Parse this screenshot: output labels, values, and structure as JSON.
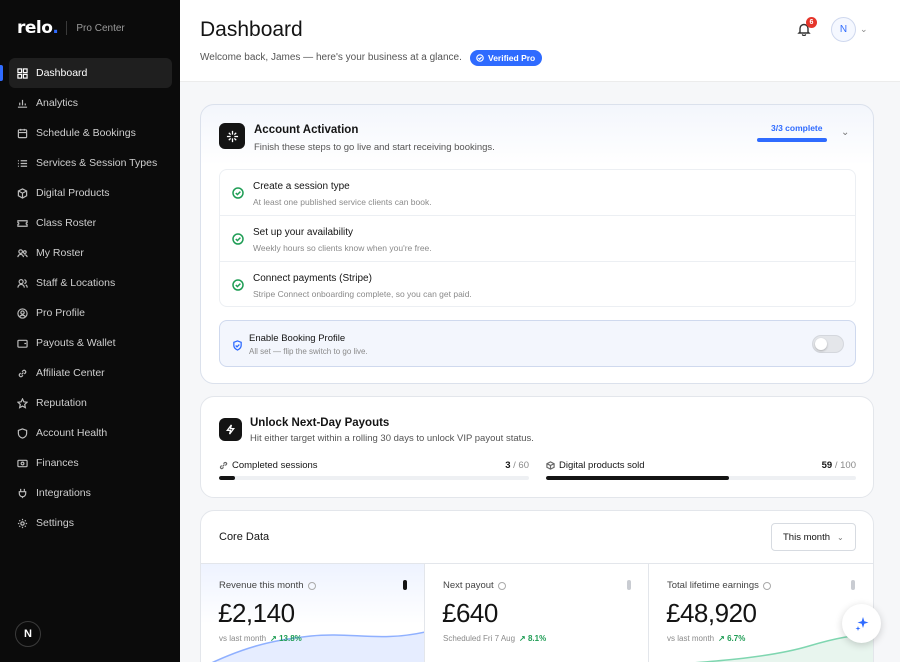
{
  "brand": {
    "logo": "relo",
    "logo_dot": ".",
    "sub": "Pro Center"
  },
  "sidebar": {
    "items": [
      {
        "label": "Dashboard",
        "icon": "grid-icon",
        "active": true
      },
      {
        "label": "Analytics",
        "icon": "chart-icon"
      },
      {
        "label": "Schedule & Bookings",
        "icon": "calendar-icon"
      },
      {
        "label": "Services & Session Types",
        "icon": "list-icon"
      },
      {
        "label": "Digital Products",
        "icon": "box-icon"
      },
      {
        "label": "Class Roster",
        "icon": "ticket-icon"
      },
      {
        "label": "My Roster",
        "icon": "users-icon"
      },
      {
        "label": "Staff & Locations",
        "icon": "team-icon"
      },
      {
        "label": "Pro Profile",
        "icon": "profile-icon"
      },
      {
        "label": "Payouts & Wallet",
        "icon": "wallet-icon"
      },
      {
        "label": "Affiliate Center",
        "icon": "link-icon"
      },
      {
        "label": "Reputation",
        "icon": "star-icon"
      },
      {
        "label": "Account Health",
        "icon": "shield-icon"
      },
      {
        "label": "Finances",
        "icon": "money-icon"
      },
      {
        "label": "Integrations",
        "icon": "plug-icon"
      },
      {
        "label": "Settings",
        "icon": "gear-icon"
      }
    ],
    "avatar": "N"
  },
  "header": {
    "title": "Dashboard",
    "welcome": "Welcome back, James — here's your business at a glance.",
    "badge": "Verified Pro",
    "notifications": "6",
    "avatar": "N"
  },
  "activation": {
    "title": "Account Activation",
    "subtitle": "Finish these steps to go live and start receiving bookings.",
    "progress_label": "3/3 complete",
    "progress": 1.0,
    "steps": [
      {
        "title": "Create a session type",
        "desc": "At least one published service clients can book."
      },
      {
        "title": "Set up your availability",
        "desc": "Weekly hours so clients know when you're free."
      },
      {
        "title": "Connect payments (Stripe)",
        "desc": "Stripe Connect onboarding complete, so you can get paid."
      }
    ],
    "booking": {
      "title": "Enable Booking Profile",
      "desc": "All set — flip the switch to go live.",
      "enabled": false
    }
  },
  "payouts": {
    "title": "Unlock Next-Day Payouts",
    "subtitle": "Hit either target within a rolling 30 days to unlock VIP payout status.",
    "metrics": [
      {
        "label": "Completed sessions",
        "current": "3",
        "target": "/ 60",
        "progress": 0.05
      },
      {
        "label": "Digital products sold",
        "current": "59",
        "target": "/ 100",
        "progress": 0.59
      }
    ]
  },
  "core": {
    "title": "Core Data",
    "period": "This month",
    "stats": [
      {
        "label": "Revenue this month",
        "value": "£2,140",
        "foot": "vs last month",
        "delta": "↗ 13.8%"
      },
      {
        "label": "Next payout",
        "value": "£640",
        "foot": "Scheduled Fri 7 Aug",
        "delta": "↗ 8.1%"
      },
      {
        "label": "Total lifetime earnings",
        "value": "£48,920",
        "foot": "vs last month",
        "delta": "↗ 6.7%"
      }
    ]
  },
  "colors": {
    "accent": "#2f6bff",
    "success": "#1f9d55",
    "sidebar": "#0b0b0b",
    "badge": "#e5352b"
  }
}
